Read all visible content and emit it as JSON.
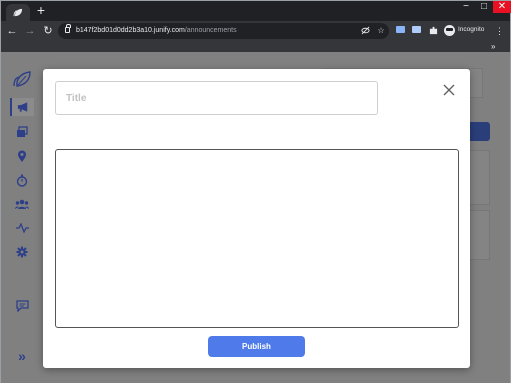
{
  "browser": {
    "url_host": "b147f2bd01d0dd2b3a10.junify.com",
    "url_path": "/announcements",
    "incognito_label": "Incognito",
    "new_tab_glyph": "+",
    "window_controls": {
      "minimize": "−",
      "maximize": "□",
      "close": "✕"
    },
    "nav": {
      "back": "←",
      "forward": "→",
      "reload": "↻"
    },
    "menu_glyph": "⋮",
    "bookmarks_chevron": "»"
  },
  "sidebar": {
    "items": [
      {
        "icon": "leaf-logo-icon"
      },
      {
        "icon": "megaphone-icon",
        "active": true
      },
      {
        "icon": "stacked-cards-icon"
      },
      {
        "icon": "location-pin-icon"
      },
      {
        "icon": "stopwatch-icon"
      },
      {
        "icon": "people-icon"
      },
      {
        "icon": "activity-pulse-icon"
      },
      {
        "icon": "gear-icon"
      },
      {
        "icon": "chat-icon"
      },
      {
        "icon": "expand-chevrons-icon"
      }
    ],
    "expand_glyph": "»"
  },
  "modal": {
    "title_placeholder": "Title",
    "title_value": "",
    "body_value": "",
    "publish_label": "Publish"
  },
  "colors": {
    "accent": "#4f7bea",
    "sidebar_icon": "#2e3f8a",
    "browser_dark": "#202124",
    "browser_toolbar": "#35363a"
  }
}
